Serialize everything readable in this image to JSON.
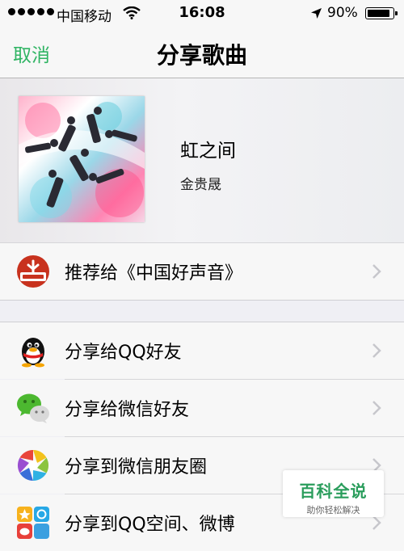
{
  "status_bar": {
    "carrier": "中国移动",
    "time": "16:08",
    "battery": "90%",
    "battery_level": 0.9
  },
  "nav": {
    "cancel": "取消",
    "title": "分享歌曲"
  },
  "song": {
    "title": "虹之间",
    "artist": "金贵晟"
  },
  "recommend": {
    "label": "推荐给《中国好声音》",
    "icon": "voice-of-china-icon"
  },
  "share_items": [
    {
      "label": "分享给QQ好友",
      "icon": "qq-penguin-icon"
    },
    {
      "label": "分享给微信好友",
      "icon": "wechat-icon"
    },
    {
      "label": "分享到微信朋友圈",
      "icon": "moments-icon"
    },
    {
      "label": "分享到QQ空间、微博",
      "icon": "qzone-weibo-icon"
    }
  ],
  "watermark": {
    "title": "百科全说",
    "subtitle": "助你轻松解决"
  },
  "colors": {
    "accent": "#2fb463",
    "background": "#efeff4"
  }
}
